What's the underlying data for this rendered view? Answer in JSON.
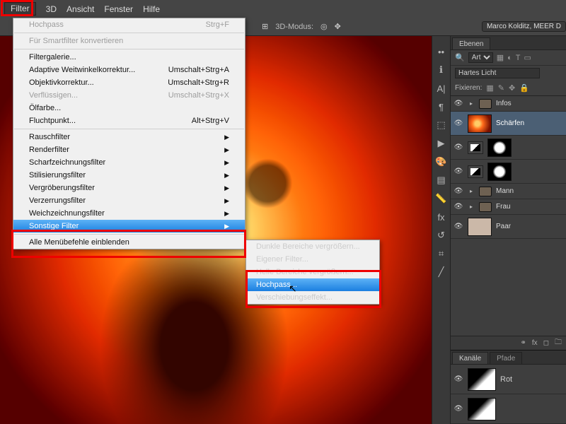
{
  "menubar": {
    "items": [
      "Filter",
      "3D",
      "Ansicht",
      "Fenster",
      "Hilfe"
    ],
    "open_index": 0
  },
  "optionbar": {
    "mode_label": "3D-Modus:",
    "doc_label": "Marco Kolditz, MEER D"
  },
  "dropdown": {
    "last": {
      "label": "Hochpass",
      "shortcut": "Strg+F"
    },
    "smart": "Für Smartfilter konvertieren",
    "gallery": "Filtergalerie...",
    "adaptive": {
      "label": "Adaptive Weitwinkelkorrektur...",
      "shortcut": "Umschalt+Strg+A"
    },
    "lens": {
      "label": "Objektivkorrektur...",
      "shortcut": "Umschalt+Strg+R"
    },
    "liquify": {
      "label": "Verflüssigen...",
      "shortcut": "Umschalt+Strg+X"
    },
    "oil": "Ölfarbe...",
    "vanish": {
      "label": "Fluchtpunkt...",
      "shortcut": "Alt+Strg+V"
    },
    "groups": [
      "Rauschfilter",
      "Renderfilter",
      "Scharfzeichnungsfilter",
      "Stilisierungsfilter",
      "Vergröberungsfilter",
      "Verzerrungsfilter",
      "Weichzeichnungsfilter",
      "Sonstige Filter"
    ],
    "showall": "Alle Menübefehle einblenden"
  },
  "submenu": {
    "items": [
      "Dunkle Bereiche vergrößern...",
      "Eigener Filter...",
      "Helle Bereiche vergrößern...",
      "Hochpass...",
      "Verschiebungseffekt..."
    ],
    "selected_index": 3
  },
  "panels": {
    "layers_tab": "Ebenen",
    "kind_label": "Art",
    "blend_mode": "Hartes Licht",
    "lock_label": "Fixieren:",
    "layers": [
      {
        "name": "Infos",
        "type": "folder"
      },
      {
        "name": "Schärfen",
        "type": "fire",
        "selected": true,
        "mask": false
      },
      {
        "name": "",
        "type": "adj",
        "mask": true
      },
      {
        "name": "",
        "type": "adj2",
        "mask": true
      },
      {
        "name": "Mann",
        "type": "folder"
      },
      {
        "name": "Frau",
        "type": "folder"
      },
      {
        "name": "Paar",
        "type": "pair"
      }
    ],
    "channels_tab": "Kanäle",
    "paths_tab": "Pfade",
    "channels": [
      {
        "name": "Rot"
      }
    ]
  },
  "icons": {
    "toolstrip": [
      "arrows",
      "info",
      "text",
      "grid",
      "play",
      "palette",
      "layers",
      "ruler",
      "fx",
      "history",
      "clone",
      "dots"
    ]
  }
}
